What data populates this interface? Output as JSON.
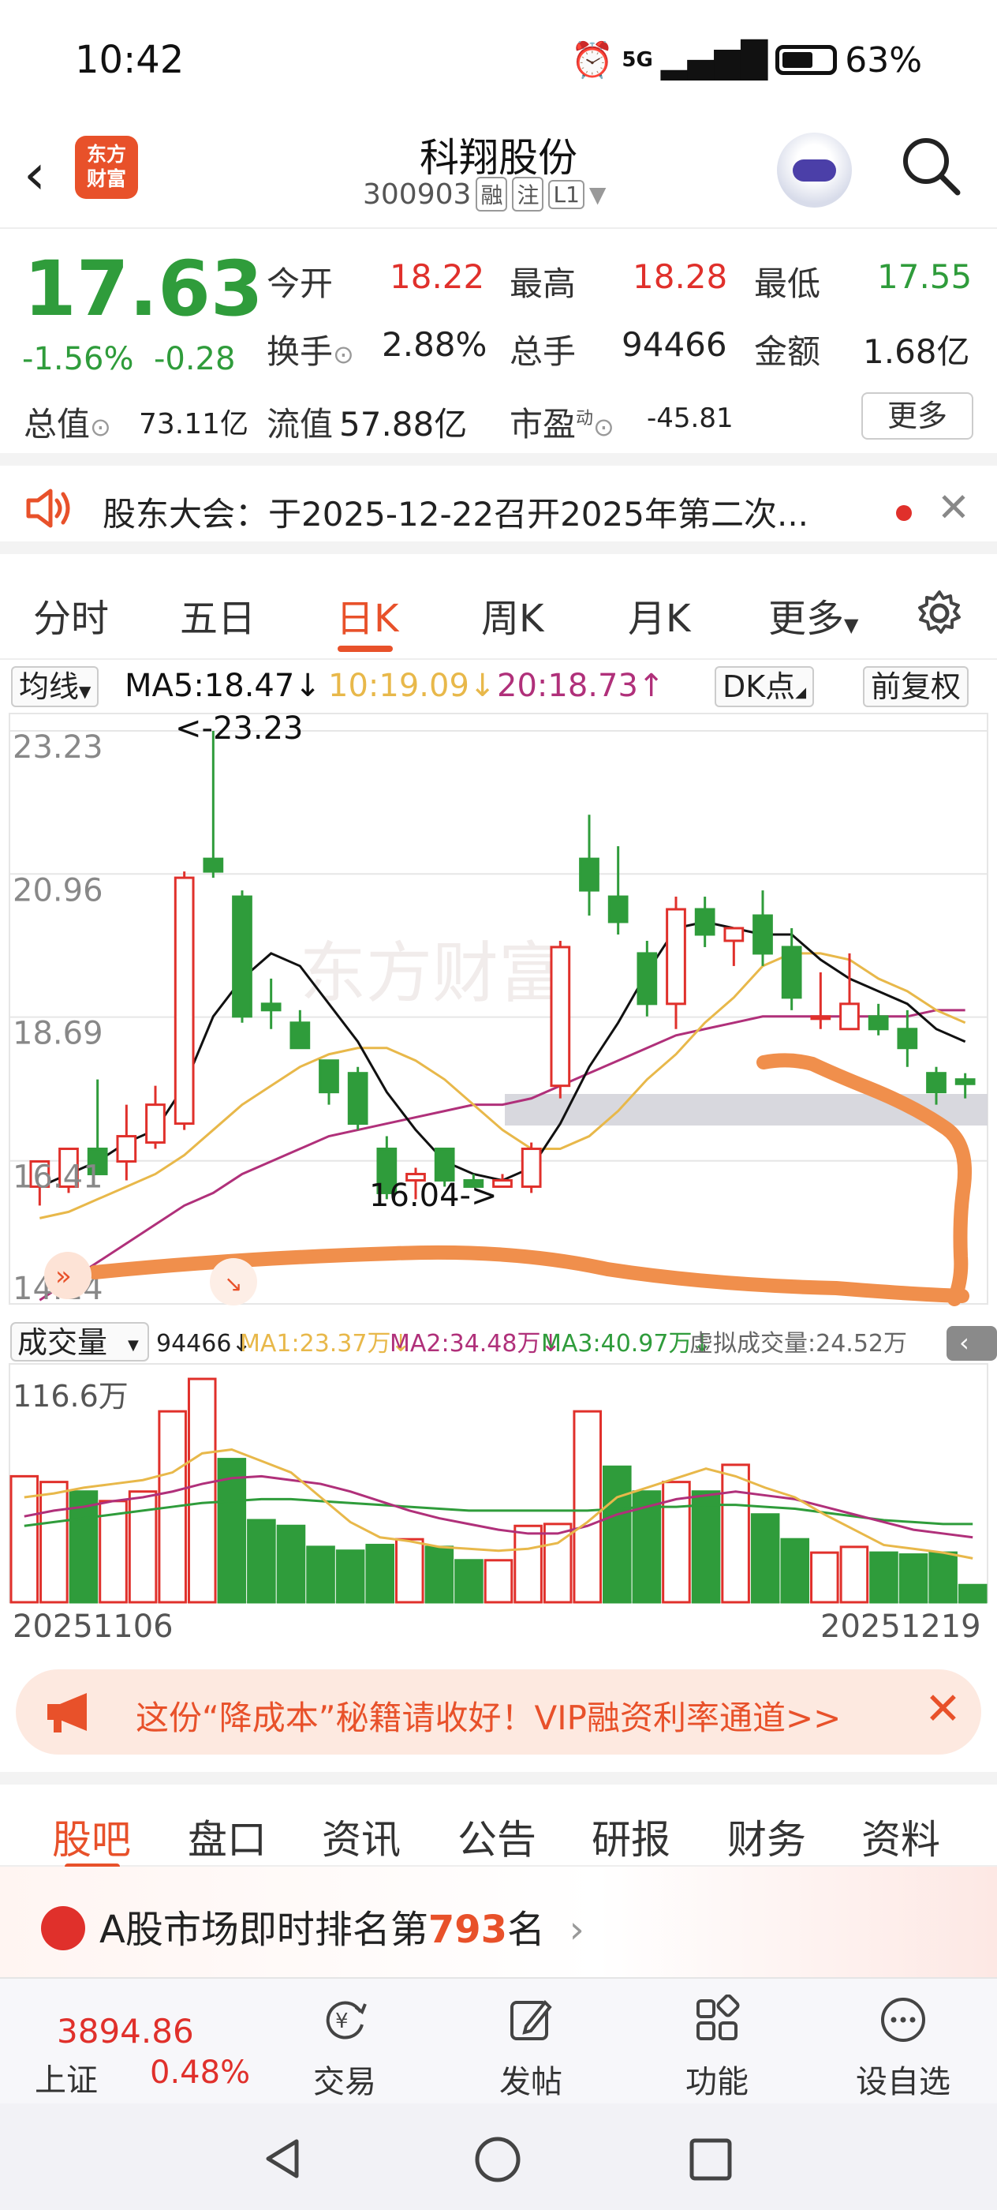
{
  "status_bar": {
    "time": "10:42",
    "network": "5G",
    "battery": "63%"
  },
  "header": {
    "back_icon": "back-icon",
    "logo_text": [
      "东方",
      "财富"
    ],
    "stock_name": "科翔股份",
    "stock_code": "300903",
    "tags": [
      "融",
      "注",
      "L1"
    ]
  },
  "quote": {
    "price": "17.63",
    "change_pct": "-1.56%",
    "change_abs": "-0.28",
    "open_label": "今开",
    "open": "18.22",
    "high_label": "最高",
    "high": "18.28",
    "low_label": "最低",
    "low": "17.55",
    "turnover_label": "换手",
    "turnover": "2.88%",
    "volume_label": "总手",
    "volume": "94466",
    "amount_label": "金额",
    "amount": "1.68亿",
    "mktcap_label": "总值",
    "mktcap": "73.11亿",
    "float_label": "流值",
    "float": "57.88亿",
    "pe_label": "市盈",
    "pe_sup": "动",
    "pe": "-45.81",
    "more": "更多"
  },
  "notice": {
    "text": "股东大会：于2025-12-22召开2025年第二次..."
  },
  "chart_tabs": {
    "items": [
      "分时",
      "五日",
      "日K",
      "周K",
      "月K",
      "更多"
    ],
    "active": "日K"
  },
  "ma_row": {
    "ma_select": "均线",
    "ma5": "MA5:18.47",
    "ma10": "10:19.09",
    "ma20": "20:18.73",
    "dk": "DK点",
    "adjust": "前复权"
  },
  "chart_data": [
    {
      "type": "candlestick",
      "y_ticks": [
        "23.23",
        "20.96",
        "18.69",
        "16.41",
        "14.14"
      ],
      "ylim": [
        14.14,
        23.23
      ],
      "annotations": [
        "<-23.23",
        "16.04->"
      ],
      "x_start": "20251106",
      "x_end": "20251219",
      "candles": [
        {
          "o": 16.0,
          "h": 16.4,
          "l": 15.7,
          "c": 16.4
        },
        {
          "o": 16.0,
          "h": 16.6,
          "l": 15.9,
          "c": 16.6
        },
        {
          "o": 16.6,
          "h": 17.7,
          "l": 16.4,
          "c": 16.2
        },
        {
          "o": 16.4,
          "h": 17.3,
          "l": 16.1,
          "c": 16.8
        },
        {
          "o": 16.7,
          "h": 17.6,
          "l": 16.6,
          "c": 17.3
        },
        {
          "o": 17.0,
          "h": 21.0,
          "l": 16.9,
          "c": 20.9
        },
        {
          "o": 21.2,
          "h": 23.23,
          "l": 20.9,
          "c": 21.0
        },
        {
          "o": 20.6,
          "h": 20.7,
          "l": 18.6,
          "c": 18.7
        },
        {
          "o": 18.9,
          "h": 19.3,
          "l": 18.5,
          "c": 18.8
        },
        {
          "o": 18.6,
          "h": 18.8,
          "l": 18.2,
          "c": 18.2
        },
        {
          "o": 18.0,
          "h": 18.0,
          "l": 17.3,
          "c": 17.5
        },
        {
          "o": 17.8,
          "h": 17.9,
          "l": 16.9,
          "c": 17.0
        },
        {
          "o": 16.6,
          "h": 16.8,
          "l": 15.8,
          "c": 15.9
        },
        {
          "o": 16.1,
          "h": 16.3,
          "l": 15.8,
          "c": 16.2
        },
        {
          "o": 16.6,
          "h": 16.6,
          "l": 16.0,
          "c": 16.1
        },
        {
          "o": 16.1,
          "h": 16.2,
          "l": 16.04,
          "c": 16.0
        },
        {
          "o": 16.0,
          "h": 16.2,
          "l": 16.04,
          "c": 16.1
        },
        {
          "o": 16.0,
          "h": 16.7,
          "l": 15.9,
          "c": 16.6
        },
        {
          "o": 17.6,
          "h": 19.9,
          "l": 17.4,
          "c": 19.8
        },
        {
          "o": 21.2,
          "h": 21.9,
          "l": 20.3,
          "c": 20.7
        },
        {
          "o": 20.6,
          "h": 21.4,
          "l": 20.0,
          "c": 20.2
        },
        {
          "o": 19.7,
          "h": 19.9,
          "l": 18.7,
          "c": 18.9
        },
        {
          "o": 18.9,
          "h": 20.6,
          "l": 18.5,
          "c": 20.4
        },
        {
          "o": 20.4,
          "h": 20.6,
          "l": 19.8,
          "c": 20.0
        },
        {
          "o": 19.9,
          "h": 20.0,
          "l": 19.5,
          "c": 20.1
        },
        {
          "o": 20.3,
          "h": 20.7,
          "l": 19.5,
          "c": 19.7
        },
        {
          "o": 19.8,
          "h": 20.1,
          "l": 18.8,
          "c": 19.0
        },
        {
          "o": 18.7,
          "h": 19.4,
          "l": 18.5,
          "c": 18.7
        },
        {
          "o": 18.5,
          "h": 19.7,
          "l": 18.5,
          "c": 18.9
        },
        {
          "o": 18.7,
          "h": 18.9,
          "l": 18.4,
          "c": 18.5
        },
        {
          "o": 18.5,
          "h": 18.8,
          "l": 17.9,
          "c": 18.2
        },
        {
          "o": 17.8,
          "h": 17.9,
          "l": 17.3,
          "c": 17.5
        },
        {
          "o": 17.7,
          "h": 17.8,
          "l": 17.4,
          "c": 17.63
        }
      ],
      "ma5": [
        16.0,
        16.2,
        16.4,
        16.7,
        16.9,
        17.6,
        18.7,
        19.3,
        19.7,
        19.5,
        18.9,
        18.3,
        17.5,
        16.9,
        16.4,
        16.2,
        16.1,
        16.3,
        17.0,
        17.9,
        18.6,
        19.4,
        20.1,
        20.2,
        20.1,
        20.0,
        20.0,
        19.6,
        19.3,
        19.1,
        18.9,
        18.5,
        18.3
      ],
      "ma10": [
        15.5,
        15.6,
        15.8,
        16.0,
        16.2,
        16.5,
        16.9,
        17.3,
        17.6,
        17.9,
        18.1,
        18.2,
        18.2,
        18.0,
        17.7,
        17.3,
        16.9,
        16.6,
        16.6,
        16.8,
        17.2,
        17.7,
        18.1,
        18.6,
        19.0,
        19.5,
        19.7,
        19.7,
        19.6,
        19.3,
        19.1,
        18.8,
        18.6
      ],
      "ma20": [
        14.2,
        14.5,
        14.8,
        15.1,
        15.4,
        15.7,
        15.9,
        16.2,
        16.4,
        16.6,
        16.8,
        16.9,
        17.0,
        17.1,
        17.2,
        17.3,
        17.3,
        17.4,
        17.6,
        17.8,
        18.0,
        18.2,
        18.4,
        18.5,
        18.6,
        18.7,
        18.7,
        18.7,
        18.7,
        18.7,
        18.7,
        18.8,
        18.8
      ]
    },
    {
      "type": "bar",
      "title": "成交量",
      "y_tick": "116.6万",
      "ylim": [
        0,
        116.6
      ],
      "total": "94466",
      "ma1": "MA1:23.37万",
      "ma2": "MA2:34.48万",
      "ma3": "MA3:40.97万",
      "virtual": "虚拟成交量:24.52万",
      "values": [
        66,
        63,
        58,
        53,
        58,
        100,
        117,
        75,
        43,
        40,
        29,
        27,
        30,
        33,
        29,
        22,
        22,
        40,
        41,
        100,
        71,
        58,
        63,
        58,
        72,
        46,
        33,
        26,
        29,
        26,
        25,
        26,
        9
      ],
      "up": [
        1,
        1,
        0,
        1,
        1,
        1,
        1,
        0,
        0,
        0,
        0,
        0,
        0,
        1,
        0,
        0,
        1,
        1,
        1,
        1,
        0,
        0,
        1,
        0,
        1,
        0,
        0,
        1,
        1,
        0,
        0,
        0,
        0
      ],
      "ma1_line": [
        55,
        57,
        60,
        62,
        64,
        68,
        78,
        80,
        74,
        68,
        55,
        42,
        34,
        32,
        29,
        28,
        27,
        28,
        31,
        42,
        55,
        60,
        65,
        70,
        66,
        60,
        55,
        46,
        38,
        30,
        28,
        26,
        23
      ],
      "ma2_line": [
        45,
        48,
        50,
        53,
        55,
        58,
        62,
        65,
        66,
        64,
        62,
        58,
        53,
        48,
        44,
        41,
        38,
        36,
        36,
        40,
        46,
        50,
        54,
        56,
        58,
        56,
        54,
        50,
        46,
        42,
        38,
        36,
        34
      ],
      "ma3_line": [
        40,
        42,
        44,
        46,
        48,
        50,
        52,
        53,
        54,
        54,
        53,
        52,
        51,
        50,
        49,
        48,
        48,
        48,
        48,
        48,
        49,
        50,
        50,
        51,
        51,
        50,
        49,
        47,
        45,
        43,
        42,
        41,
        41
      ]
    }
  ],
  "banner": {
    "text": "这份“降成本”秘籍请收好！VIP融资利率通道>>"
  },
  "section_tabs": {
    "items": [
      "股吧",
      "盘口",
      "资讯",
      "公告",
      "研报",
      "财务",
      "资料"
    ],
    "active": "股吧"
  },
  "rank": {
    "prefix": "A股市场即时排名第",
    "rank": "793",
    "suffix": "名"
  },
  "toolbar": {
    "index_value": "3894.86",
    "index_name": "上证",
    "index_pct": "0.48%",
    "items": [
      "交易",
      "发帖",
      "功能",
      "设自选"
    ]
  },
  "colors": {
    "red": "#e0302b",
    "green": "#2f9c3b",
    "accent": "#e8512a",
    "ma5": "#111111",
    "ma10": "#e8b84a",
    "ma20": "#b0307a"
  }
}
